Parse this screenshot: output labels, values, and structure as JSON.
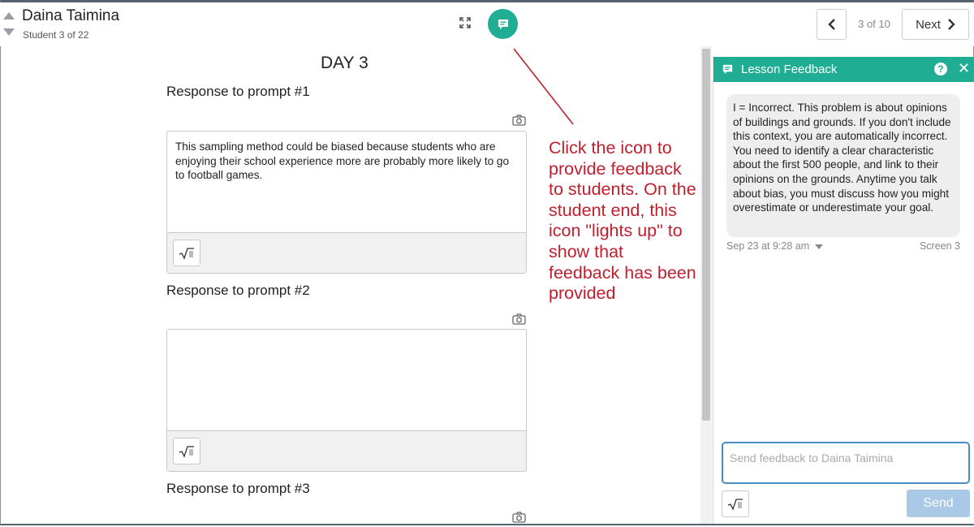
{
  "header": {
    "student_name": "Daina Taimina",
    "student_count": "Student 3 of 22",
    "page_indicator": "3 of 10",
    "next_label": "Next"
  },
  "main": {
    "day_title": "DAY 3",
    "prompts": [
      {
        "label": "Response to prompt #1",
        "response": "This sampling method could be biased because students who are enjoying their school experience more are probably more likely to go to football games."
      },
      {
        "label": "Response to prompt #2",
        "response": ""
      },
      {
        "label": "Response to prompt #3",
        "response": ""
      }
    ]
  },
  "annotation": {
    "text": "Click the icon to provide feedback to students. On the student end, this icon \"lights up\" to show that feedback has been provided",
    "color": "#c0202e"
  },
  "feedback_panel": {
    "title": "Lesson Feedback",
    "message": "I = Incorrect. This problem is about opinions of buildings and grounds. If you don't include this context, you are automatically incorrect. You need to identify a clear characteristic about the first 500 people, and link to their opinions on the grounds. Anytime you talk about bias, you must discuss how you might overestimate or underestimate your goal.",
    "message_date": "Sep 23 at 9:28 am",
    "message_screen": "Screen 3",
    "input_placeholder": "Send feedback to Daina Taimina",
    "send_label": "Send",
    "help_symbol": "?",
    "close_symbol": "✕"
  },
  "colors": {
    "accent": "#1fae93",
    "send_disabled": "#a9c9e6",
    "input_focus": "#4a8bc4"
  }
}
